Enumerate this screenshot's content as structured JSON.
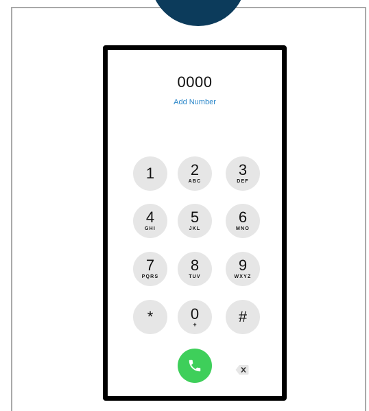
{
  "dialer": {
    "number": "0000",
    "add_number_label": "Add Number",
    "keys": [
      {
        "digit": "1",
        "letters": ""
      },
      {
        "digit": "2",
        "letters": "ABC"
      },
      {
        "digit": "3",
        "letters": "DEF"
      },
      {
        "digit": "4",
        "letters": "GHI"
      },
      {
        "digit": "5",
        "letters": "JKL"
      },
      {
        "digit": "6",
        "letters": "MNO"
      },
      {
        "digit": "7",
        "letters": "PQRS"
      },
      {
        "digit": "8",
        "letters": "TUV"
      },
      {
        "digit": "9",
        "letters": "WXYZ"
      },
      {
        "digit": "*",
        "letters": ""
      },
      {
        "digit": "0",
        "letters": "+"
      },
      {
        "digit": "#",
        "letters": ""
      }
    ],
    "call_icon": "phone-icon",
    "delete_icon": "backspace-icon"
  },
  "colors": {
    "badge": "#0c3b5b",
    "call_green": "#3ecf5a",
    "key_gray": "#e6e6e6",
    "link_blue": "#2a86c9"
  }
}
